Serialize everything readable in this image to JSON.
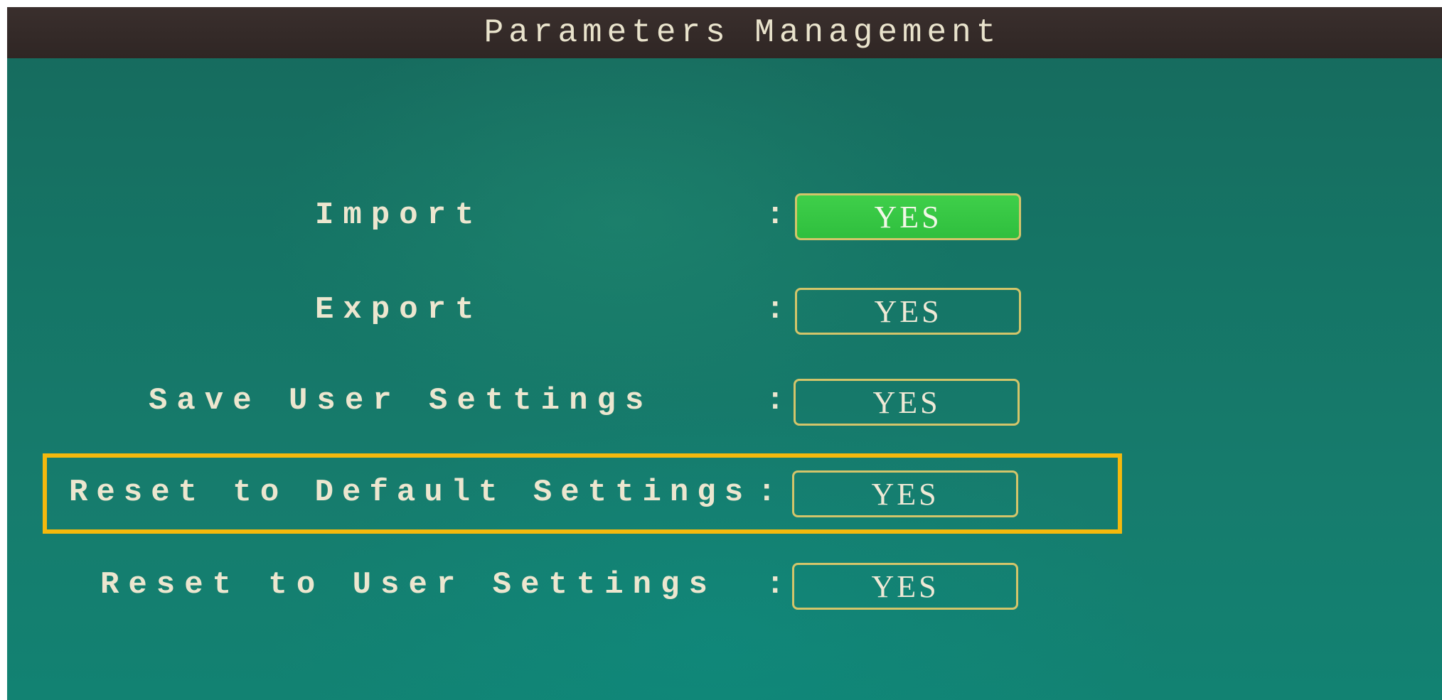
{
  "window": {
    "title": "Parameters Management"
  },
  "rows": [
    {
      "label": "Import",
      "colon": ":",
      "button": "YES",
      "selected": true
    },
    {
      "label": "Export",
      "colon": ":",
      "button": "YES",
      "selected": false
    },
    {
      "label": "Save User Settings",
      "colon": ":",
      "button": "YES",
      "selected": false
    },
    {
      "label": "Reset to Default Settings",
      "colon": ":",
      "button": "YES",
      "selected": false
    },
    {
      "label": "Reset to User Settings",
      "colon": ":",
      "button": "YES",
      "selected": false
    }
  ],
  "colors": {
    "title_bar": "#2f2624",
    "background": "#157465",
    "text": "#ece6cf",
    "button_border": "#d3c56a",
    "button_selected": "#2fbf3e",
    "highlight": "#f4b90d"
  },
  "annotation": {
    "highlighted_row": "Reset to Default Settings"
  }
}
